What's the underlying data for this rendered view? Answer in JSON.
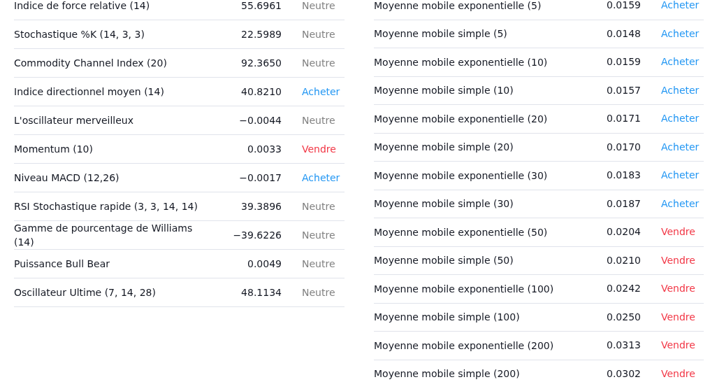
{
  "oscillators": [
    {
      "name": "Indice de force relative (14)",
      "value": "55.6961",
      "signal": "Neutre",
      "kind": "neutral"
    },
    {
      "name": "Stochastique %K (14, 3, 3)",
      "value": "22.5989",
      "signal": "Neutre",
      "kind": "neutral"
    },
    {
      "name": "Commodity Channel Index (20)",
      "value": "92.3650",
      "signal": "Neutre",
      "kind": "neutral"
    },
    {
      "name": "Indice directionnel moyen (14)",
      "value": "40.8210",
      "signal": "Acheter",
      "kind": "buy"
    },
    {
      "name": "L'oscillateur merveilleux",
      "value": "−0.0044",
      "signal": "Neutre",
      "kind": "neutral"
    },
    {
      "name": "Momentum (10)",
      "value": "0.0033",
      "signal": "Vendre",
      "kind": "sell"
    },
    {
      "name": "Niveau MACD (12,26)",
      "value": "−0.0017",
      "signal": "Acheter",
      "kind": "buy"
    },
    {
      "name": "RSI Stochastique rapide (3, 3, 14, 14)",
      "value": "39.3896",
      "signal": "Neutre",
      "kind": "neutral"
    },
    {
      "name": "Gamme de pourcentage de Williams (14)",
      "value": "−39.6226",
      "signal": "Neutre",
      "kind": "neutral"
    },
    {
      "name": "Puissance Bull Bear",
      "value": "0.0049",
      "signal": "Neutre",
      "kind": "neutral"
    },
    {
      "name": "Oscillateur Ultime (7, 14, 28)",
      "value": "48.1134",
      "signal": "Neutre",
      "kind": "neutral"
    }
  ],
  "moving_averages": [
    {
      "name": "Moyenne mobile exponentielle (5)",
      "value": "0.0159",
      "signal": "Acheter",
      "kind": "buy"
    },
    {
      "name": "Moyenne mobile simple (5)",
      "value": "0.0148",
      "signal": "Acheter",
      "kind": "buy"
    },
    {
      "name": "Moyenne mobile exponentielle (10)",
      "value": "0.0159",
      "signal": "Acheter",
      "kind": "buy"
    },
    {
      "name": "Moyenne mobile simple (10)",
      "value": "0.0157",
      "signal": "Acheter",
      "kind": "buy"
    },
    {
      "name": "Moyenne mobile exponentielle (20)",
      "value": "0.0171",
      "signal": "Acheter",
      "kind": "buy"
    },
    {
      "name": "Moyenne mobile simple (20)",
      "value": "0.0170",
      "signal": "Acheter",
      "kind": "buy"
    },
    {
      "name": "Moyenne mobile exponentielle (30)",
      "value": "0.0183",
      "signal": "Acheter",
      "kind": "buy"
    },
    {
      "name": "Moyenne mobile simple (30)",
      "value": "0.0187",
      "signal": "Acheter",
      "kind": "buy"
    },
    {
      "name": "Moyenne mobile exponentielle (50)",
      "value": "0.0204",
      "signal": "Vendre",
      "kind": "sell"
    },
    {
      "name": "Moyenne mobile simple (50)",
      "value": "0.0210",
      "signal": "Vendre",
      "kind": "sell"
    },
    {
      "name": "Moyenne mobile exponentielle (100)",
      "value": "0.0242",
      "signal": "Vendre",
      "kind": "sell"
    },
    {
      "name": "Moyenne mobile simple (100)",
      "value": "0.0250",
      "signal": "Vendre",
      "kind": "sell"
    },
    {
      "name": "Moyenne mobile exponentielle (200)",
      "value": "0.0313",
      "signal": "Vendre",
      "kind": "sell"
    },
    {
      "name": "Moyenne mobile simple (200)",
      "value": "0.0302",
      "signal": "Vendre",
      "kind": "sell"
    }
  ]
}
